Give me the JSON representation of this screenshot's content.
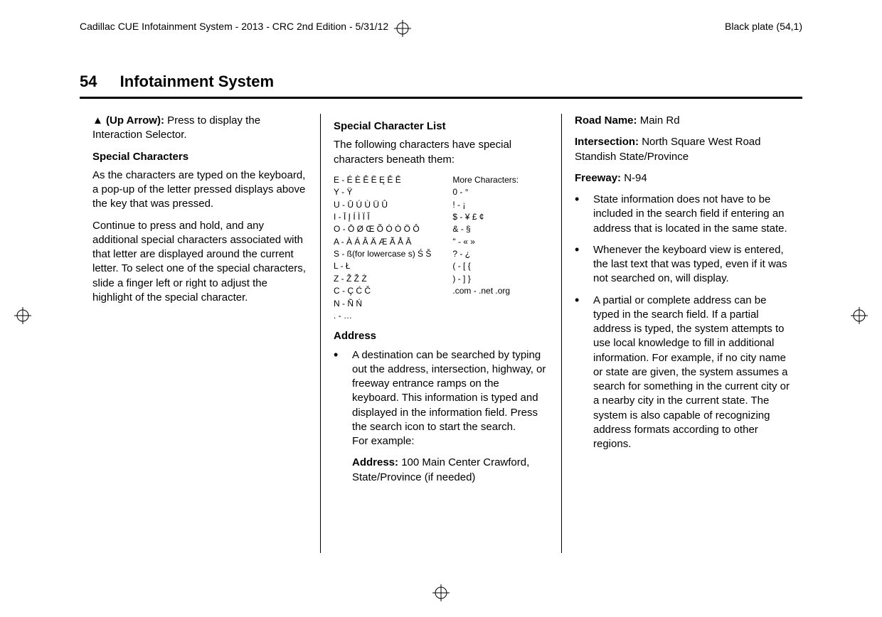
{
  "header": {
    "left": "Cadillac CUE Infotainment System - 2013 - CRC 2nd Edition - 5/31/12",
    "right": "Black plate (54,1)"
  },
  "title": {
    "page": "54",
    "text": "Infotainment System"
  },
  "col1": {
    "uparrow_icon": "▲",
    "uparrow_label": "(Up Arrow):",
    "uparrow_desc": "Press to display the Interaction Selector.",
    "sc_h": "Special Characters",
    "sc_p1": "As the characters are typed on the keyboard, a pop-up of the letter pressed displays above the key that was pressed.",
    "sc_p2": "Continue to press and hold, and any additional special characters associated with that letter are displayed around the current letter. To select one of the special characters, slide a finger left or right to adjust the highlight of the special character."
  },
  "col2": {
    "scl_h": "Special Character List",
    "scl_p": "The following characters have special characters beneath them:",
    "tbl_left": [
      "E - É È Ê Ë Ę Ě Ē",
      "Y - Ÿ",
      "U - Ū Ú Ù Ü Û",
      "I - Ī Į Í Ì Ï Î",
      "O - Ō Ø Œ Õ Ó Ò Ö Ô",
      "A - À Á Â Ä Æ Ã Å Ā",
      "S - ß(for lowercase s) Ś Š",
      "L - Ł",
      "Z - Ž Ž Ż",
      "C - Ç Ć Č",
      "N - Ñ Ń",
      ". - …"
    ],
    "tbl_right_h": "More Characters:",
    "tbl_right": [
      "0 - °",
      "! - ¡",
      "$ - ¥ £ ¢",
      "& - §",
      "\" - « »",
      "? - ¿",
      "( - [ {",
      ") - ] }",
      ".com - .net .org"
    ],
    "addr_h": "Address",
    "addr_b1": "A destination can be searched by typing out the address, intersection, highway, or freeway entrance ramps on the keyboard. This information is typed and displayed in the information field. Press the search icon to start the search.",
    "addr_eg": "For example:",
    "addr_l": "Address:",
    "addr_v": "100 Main Center Crawford, State/Province (if needed)"
  },
  "col3": {
    "road_l": "Road Name:",
    "road_v": "Main Rd",
    "int_l": "Intersection:",
    "int_v": "North Square West Road Standish State/Province",
    "fwy_l": "Freeway:",
    "fwy_v": "N-94",
    "b1": "State information does not have to be included in the search field if entering an address that is located in the same state.",
    "b2": "Whenever the keyboard view is entered, the last text that was typed, even if it was not searched on, will display.",
    "b3": "A partial or complete address can be typed in the search field. If a partial address is typed, the system attempts to use local knowledge to fill in additional information. For example, if no city name or state are given, the system assumes a search for something in the current city or a nearby city in the current state. The system is also capable of recognizing address formats according to other regions."
  }
}
